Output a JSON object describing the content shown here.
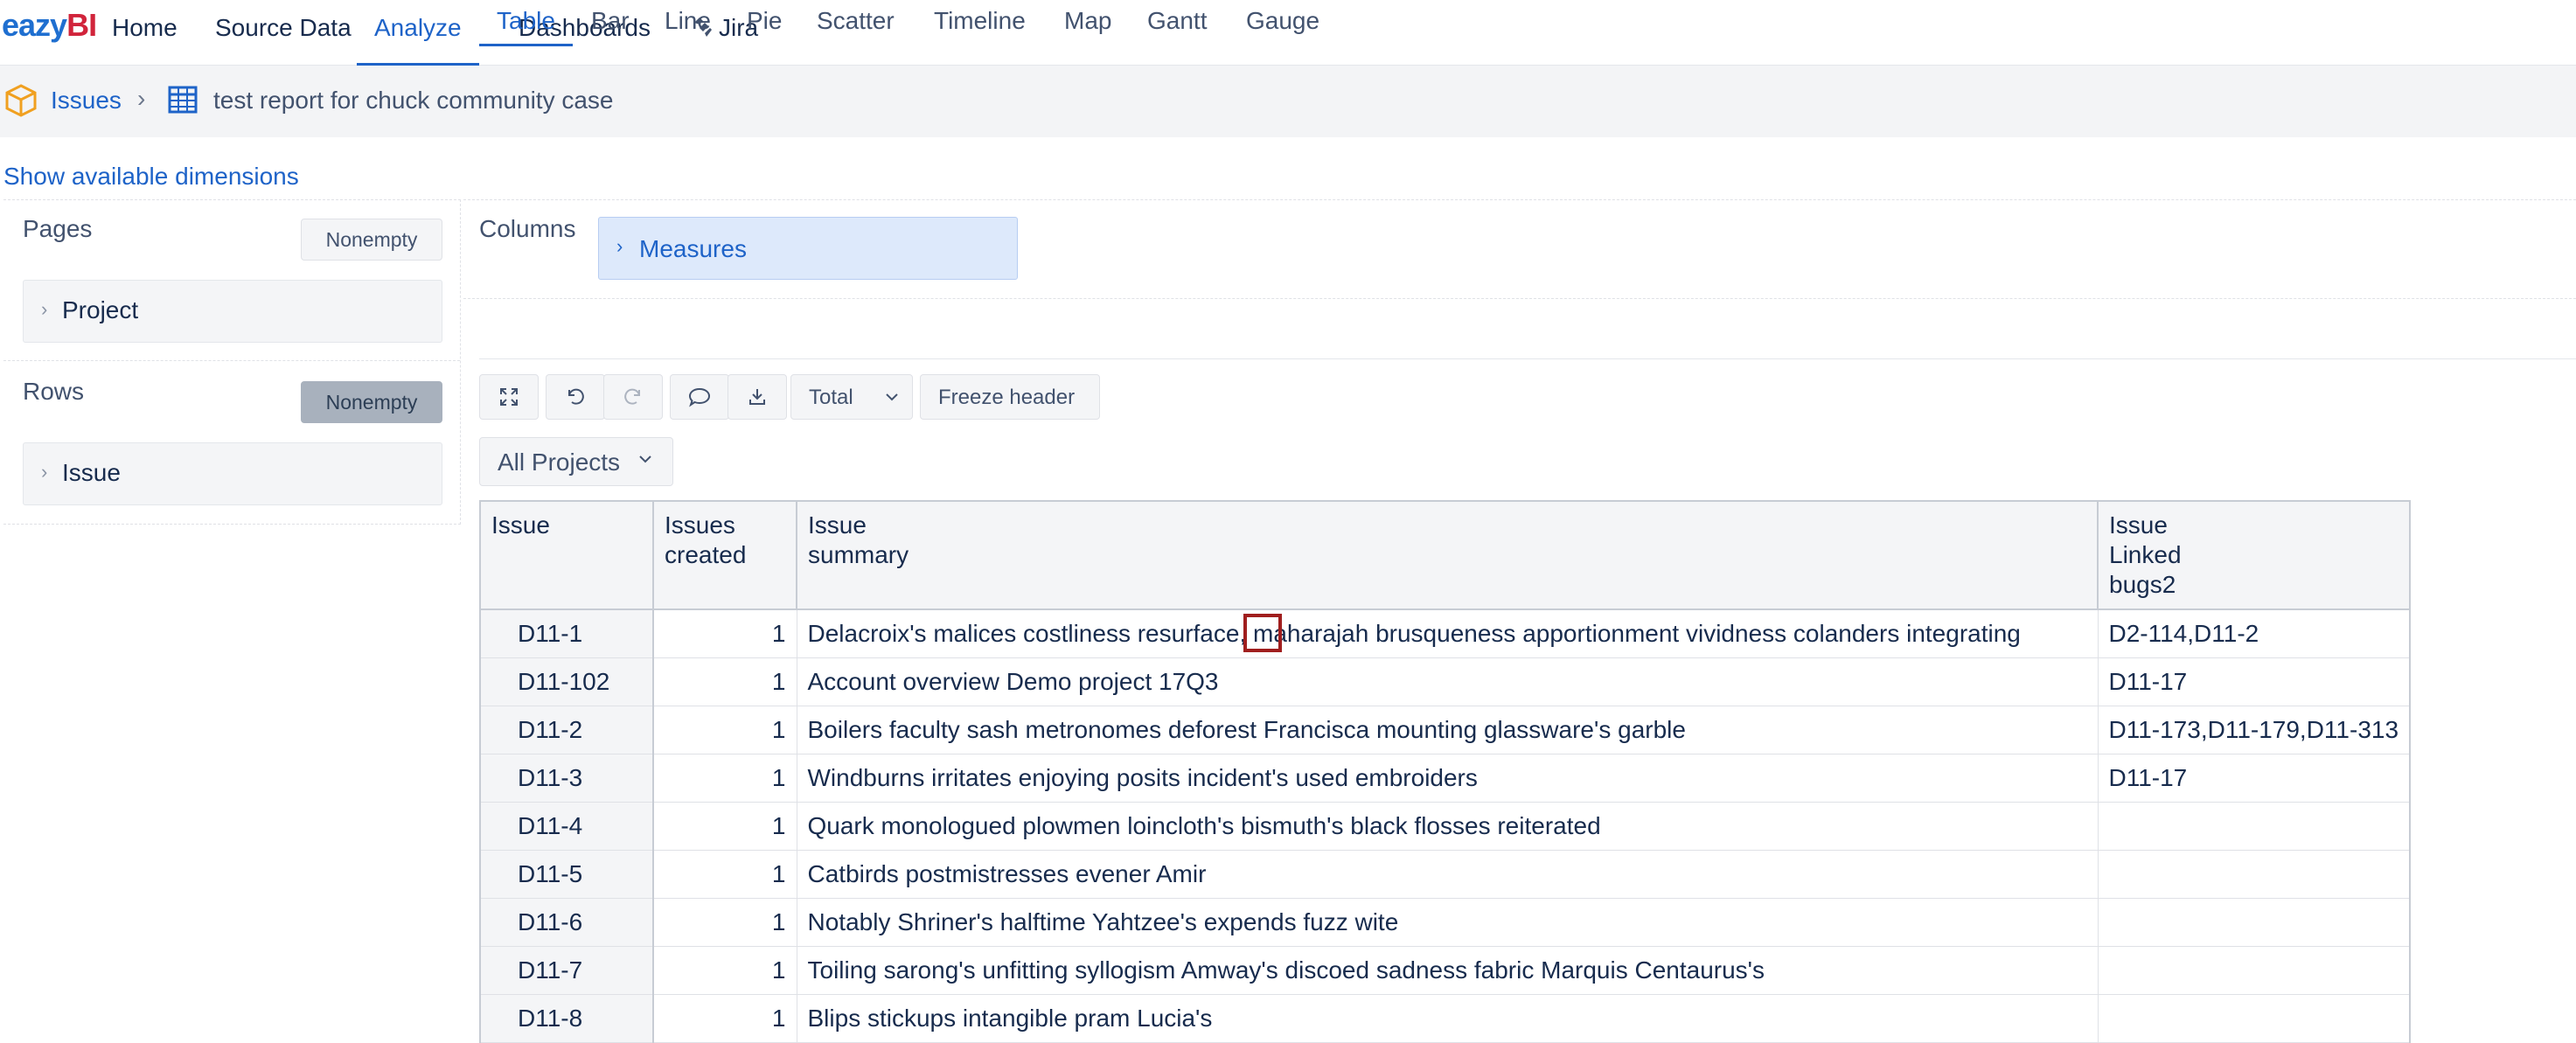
{
  "nav": {
    "logo": {
      "part1": "eazy",
      "part2": "BI"
    },
    "items": [
      {
        "label": "Home"
      },
      {
        "label": "Source Data"
      },
      {
        "label": "Analyze"
      },
      {
        "label": "Dashboards"
      },
      {
        "label": "Jira"
      }
    ],
    "active": "Analyze"
  },
  "breadcrumb": {
    "cube": "Issues",
    "separator": "›",
    "report": "test report for chuck community case"
  },
  "show_dimensions": "Show available dimensions",
  "layout_panel": {
    "pages_label": "Pages",
    "rows_label": "Rows",
    "columns_label": "Columns",
    "nonempty_label": "Nonempty",
    "pages_dimension": "Project",
    "rows_dimension": "Issue",
    "columns_dimension": "Measures"
  },
  "view_tabs": [
    "Table",
    "Bar",
    "Line",
    "Pie",
    "Scatter",
    "Timeline",
    "Map",
    "Gantt",
    "Gauge"
  ],
  "active_view": "Table",
  "toolbar": {
    "total_label": "Total",
    "freeze_label": "Freeze header"
  },
  "project_select": "All Projects",
  "table": {
    "headers": [
      [
        "Issue"
      ],
      [
        "Issues",
        "created"
      ],
      [
        "Issue",
        "summary"
      ],
      [
        "Issue",
        "Linked",
        "bugs2"
      ]
    ],
    "rows": [
      {
        "issue": "D11-1",
        "created": "1",
        "summary": "Delacroix's malices costliness resurface, maharajah brusqueness apportionment vividness colanders integrating",
        "linked": "D2-114,D11-2"
      },
      {
        "issue": "D11-102",
        "created": "1",
        "summary": "Account overview Demo project 17Q3",
        "linked": "D11-17"
      },
      {
        "issue": "D11-2",
        "created": "1",
        "summary": "Boilers faculty sash metronomes deforest Francisca mounting glassware's garble",
        "linked": "D11-173,D11-179,D11-313"
      },
      {
        "issue": "D11-3",
        "created": "1",
        "summary": "Windburns irritates enjoying posits incident's used embroiders",
        "linked": "D11-17"
      },
      {
        "issue": "D11-4",
        "created": "1",
        "summary": "Quark monologued plowmen loincloth's bismuth's black flosses reiterated",
        "linked": ""
      },
      {
        "issue": "D11-5",
        "created": "1",
        "summary": "Catbirds postmistresses evener Amir",
        "linked": ""
      },
      {
        "issue": "D11-6",
        "created": "1",
        "summary": "Notably Shriner's halftime Yahtzee's expends fuzz wite",
        "linked": ""
      },
      {
        "issue": "D11-7",
        "created": "1",
        "summary": "Toiling sarong's unfitting syllogism Amway's discoed sadness fabric Marquis Centaurus's",
        "linked": ""
      },
      {
        "issue": "D11-8",
        "created": "1",
        "summary": "Blips stickups intangible pram Lucia's",
        "linked": ""
      }
    ]
  },
  "colors": {
    "accent": "#1e63c8",
    "logo_blue": "#1f6fd0",
    "logo_red": "#d1243b",
    "highlight": "#a01e1e"
  }
}
